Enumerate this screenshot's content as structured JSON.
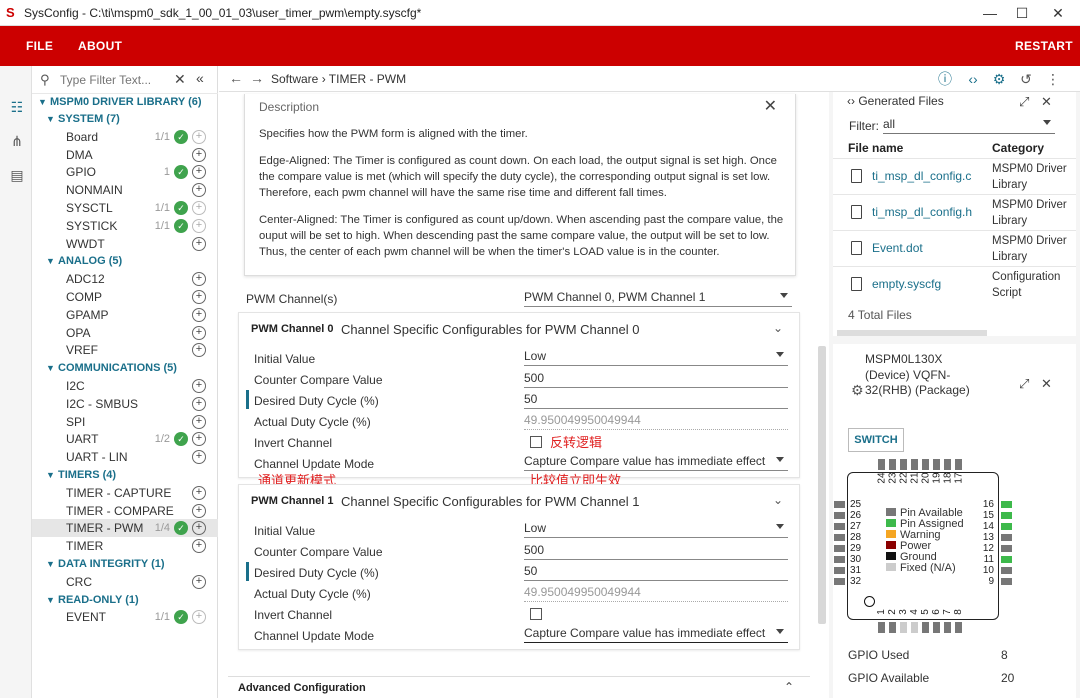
{
  "window": {
    "title": "SysConfig - C:\\ti\\mspm0_sdk_1_00_01_03\\user_timer_pwm\\empty.syscfg*"
  },
  "menu": {
    "file": "FILE",
    "about": "ABOUT",
    "restart": "RESTART"
  },
  "sidebar": {
    "filter_placeholder": "Type Filter Text...",
    "root": "MSPM0 DRIVER LIBRARY (6)",
    "items": [
      {
        "kind": "cat",
        "label": "SYSTEM (7)"
      },
      {
        "kind": "mod",
        "label": "Board",
        "count": "1/1",
        "ok": true
      },
      {
        "kind": "mod",
        "label": "DMA",
        "count": "",
        "ok": false
      },
      {
        "kind": "mod",
        "label": "GPIO",
        "count": "1",
        "ok": true
      },
      {
        "kind": "mod",
        "label": "NONMAIN",
        "count": "",
        "ok": false
      },
      {
        "kind": "mod",
        "label": "SYSCTL",
        "count": "1/1",
        "ok": true
      },
      {
        "kind": "mod",
        "label": "SYSTICK",
        "count": "1/1",
        "ok": true
      },
      {
        "kind": "mod",
        "label": "WWDT",
        "count": "",
        "ok": false
      },
      {
        "kind": "cat",
        "label": "ANALOG (5)"
      },
      {
        "kind": "mod",
        "label": "ADC12",
        "count": "",
        "ok": false
      },
      {
        "kind": "mod",
        "label": "COMP",
        "count": "",
        "ok": false
      },
      {
        "kind": "mod",
        "label": "GPAMP",
        "count": "",
        "ok": false
      },
      {
        "kind": "mod",
        "label": "OPA",
        "count": "",
        "ok": false
      },
      {
        "kind": "mod",
        "label": "VREF",
        "count": "",
        "ok": false
      },
      {
        "kind": "cat",
        "label": "COMMUNICATIONS (5)"
      },
      {
        "kind": "mod",
        "label": "I2C",
        "count": "",
        "ok": false
      },
      {
        "kind": "mod",
        "label": "I2C - SMBUS",
        "count": "",
        "ok": false
      },
      {
        "kind": "mod",
        "label": "SPI",
        "count": "",
        "ok": false
      },
      {
        "kind": "mod",
        "label": "UART",
        "count": "1/2",
        "ok": true
      },
      {
        "kind": "mod",
        "label": "UART - LIN",
        "count": "",
        "ok": false
      },
      {
        "kind": "cat",
        "label": "TIMERS (4)"
      },
      {
        "kind": "mod",
        "label": "TIMER - CAPTURE",
        "count": "",
        "ok": false
      },
      {
        "kind": "mod",
        "label": "TIMER - COMPARE",
        "count": "",
        "ok": false
      },
      {
        "kind": "mod",
        "label": "TIMER - PWM",
        "count": "1/4",
        "ok": true,
        "selected": true
      },
      {
        "kind": "mod",
        "label": "TIMER",
        "count": "",
        "ok": false
      },
      {
        "kind": "cat",
        "label": "DATA INTEGRITY (1)"
      },
      {
        "kind": "mod",
        "label": "CRC",
        "count": "",
        "ok": false
      },
      {
        "kind": "cat",
        "label": "READ-ONLY (1)"
      },
      {
        "kind": "mod",
        "label": "EVENT",
        "count": "1/1",
        "ok": true
      }
    ]
  },
  "nav": {
    "crumb": "Software  ›  TIMER - PWM"
  },
  "description": {
    "header": "Description",
    "p1": "Specifies how the PWM form is aligned with the timer.",
    "p2": "Edge-Aligned: The Timer is configured as count down. On each load, the output signal is set high. Once the compare value is met (which will specify the duty cycle), the corresponding output signal is set low. Therefore, each pwm channel will have the same rise time and different fall times.",
    "p3": "Center-Aligned: The Timer is configured as count up/down. When ascending past the compare value, the ouput will be set to high. When descending past the same compare value, the output will be set to low. Thus, the center of each pwm channel will be when the timer's LOAD value is in the counter."
  },
  "pwm": {
    "channels_label": "PWM Channel(s)",
    "channels_value": "PWM Channel 0, PWM Channel 1",
    "ch0": {
      "title": "PWM Channel 0",
      "subtitle": "Channel Specific Configurables for PWM Channel 0",
      "initial_label": "Initial Value",
      "initial_value": "Low",
      "ccv_label": "Counter Compare Value",
      "ccv_value": "500",
      "duty_label": "Desired Duty Cycle (%)",
      "duty_value": "50",
      "actual_label": "Actual Duty Cycle (%)",
      "actual_value": "49.950049950049944",
      "invert_label": "Invert Channel",
      "mode_label": "Channel Update Mode",
      "mode_value": "Capture Compare value has immediate effect"
    },
    "ch1": {
      "title": "PWM Channel 1",
      "subtitle": "Channel Specific Configurables for PWM Channel 1",
      "initial_label": "Initial Value",
      "initial_value": "Low",
      "ccv_label": "Counter Compare Value",
      "ccv_value": "500",
      "duty_label": "Desired Duty Cycle (%)",
      "duty_value": "50",
      "actual_label": "Actual Duty Cycle (%)",
      "actual_value": "49.950049950049944",
      "invert_label": "Invert Channel",
      "mode_label": "Channel Update Mode",
      "mode_value": "Capture Compare value has immediate effect"
    }
  },
  "annotations": {
    "invert": "反转逻辑",
    "mode": "通道更新模式",
    "compare": "比较值立即生效"
  },
  "advanced": "Advanced Configuration",
  "generated": {
    "header": "Generated Files",
    "filter_label": "Filter:",
    "filter_value": "all",
    "col_name": "File name",
    "col_cat": "Category",
    "files": [
      {
        "name": "ti_msp_dl_config.c",
        "cat": "MSPM0 Driver Library"
      },
      {
        "name": "ti_msp_dl_config.h",
        "cat": "MSPM0 Driver Library"
      },
      {
        "name": "Event.dot",
        "cat": "MSPM0 Driver Library"
      },
      {
        "name": "empty.syscfg",
        "cat": "Configuration Script"
      }
    ],
    "total": "4 Total Files"
  },
  "device": {
    "name": "MSPM0L130X (Device) VQFN-32(RHB) (Package)",
    "switch": "SWITCH",
    "pins_top": [
      "24",
      "23",
      "22",
      "21",
      "20",
      "19",
      "18",
      "17"
    ],
    "pins_left": [
      "25",
      "26",
      "27",
      "28",
      "29",
      "30",
      "31",
      "32"
    ],
    "pins_right": [
      "16",
      "15",
      "14",
      "13",
      "12",
      "11",
      "10",
      "9"
    ],
    "pins_bottom": [
      "1",
      "2",
      "3",
      "4",
      "5",
      "6",
      "7",
      "8"
    ],
    "legend": [
      {
        "label": "Pin Available",
        "color": "#777777"
      },
      {
        "label": "Pin Assigned",
        "color": "#3db94b"
      },
      {
        "label": "Warning",
        "color": "#f5a623"
      },
      {
        "label": "Power",
        "color": "#8b0000"
      },
      {
        "label": "Ground",
        "color": "#111111"
      },
      {
        "label": "Fixed (N/A)",
        "color": "#cccccc"
      }
    ],
    "gpio_used_label": "GPIO Used",
    "gpio_used": "8",
    "gpio_avail_label": "GPIO Available",
    "gpio_avail": "20"
  },
  "colors": {
    "brand": "#cc0000",
    "accent": "#1a6f8a",
    "ok": "#3fa34d"
  }
}
